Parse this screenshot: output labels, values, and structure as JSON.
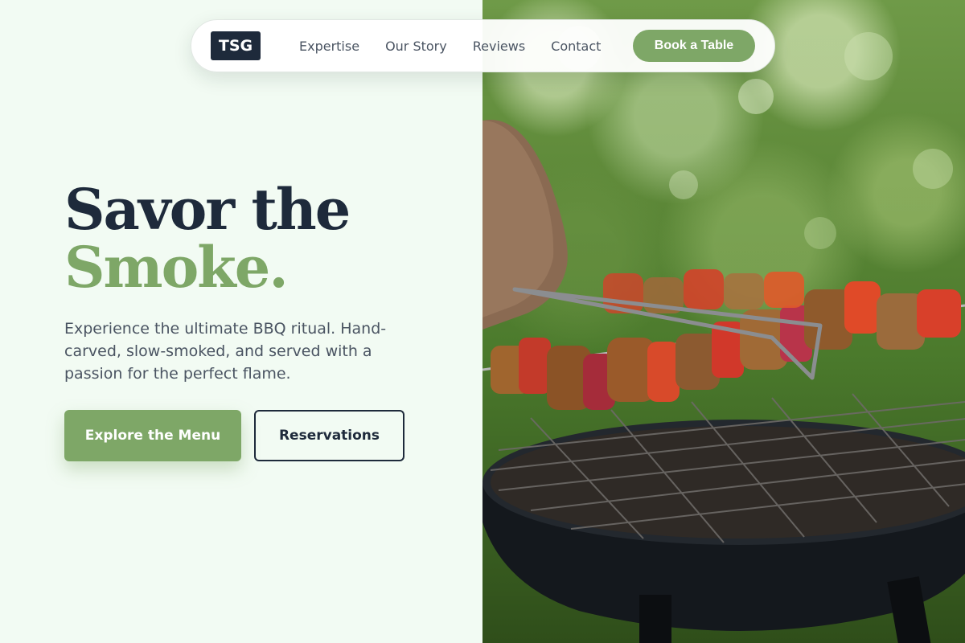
{
  "nav": {
    "logo": "TSG",
    "links": [
      "Expertise",
      "Our Story",
      "Reviews",
      "Contact"
    ],
    "cta_label": "Book a Table"
  },
  "hero": {
    "headline_line1": "Savor the",
    "headline_line2": "Smoke.",
    "description": "Experience the ultimate BBQ ritual. Hand-carved, slow-smoked, and served with a passion for the perfect flame.",
    "primary_button": "Explore the Menu",
    "secondary_button": "Reservations"
  },
  "photo": {
    "subject": "bbq-skewers-on-grill"
  },
  "colors": {
    "accent_green": "#7ea767",
    "dark_navy": "#1e2a3b",
    "body_text": "#4a5462",
    "background": "#f2fbf3"
  }
}
